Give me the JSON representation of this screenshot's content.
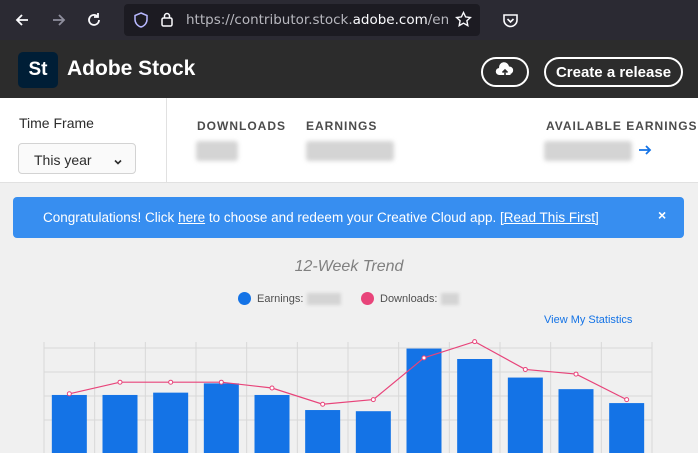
{
  "browser": {
    "url_prefix": "https://contributor.stock.",
    "url_domain": "adobe.com",
    "url_suffix": "/en/po"
  },
  "header": {
    "logo_text": "St",
    "brand": "Adobe Stock",
    "create_label": "Create a release"
  },
  "stats": {
    "time_frame_label": "Time Frame",
    "time_frame_value": "This year",
    "downloads_label": "DOWNLOADS",
    "earnings_label": "EARNINGS",
    "available_label": "AVAILABLE EARNINGS"
  },
  "banner": {
    "text_before": "Congratulations! Click ",
    "link_here": "here",
    "text_after": " to choose and redeem your Creative Cloud app. ",
    "link_read": "[Read This First]",
    "close": "×"
  },
  "chart": {
    "view_stats": "View My Statistics",
    "colors": {
      "bar": "#1473e6",
      "line": "#e8447a"
    }
  },
  "chart_data": {
    "type": "bar",
    "title": "12-Week Trend",
    "series": [
      {
        "name": "Earnings:",
        "kind": "bar",
        "color": "#1473e6",
        "values": [
          44,
          44,
          46,
          54,
          44,
          31,
          30,
          84,
          75,
          59,
          49,
          37
        ]
      },
      {
        "name": "Downloads:",
        "kind": "line",
        "color": "#e8447a",
        "values": [
          45,
          55,
          55,
          55,
          50,
          36,
          40,
          76,
          90,
          66,
          62,
          40
        ]
      }
    ],
    "ylim": [
      0,
      100
    ],
    "grid": true,
    "legend": "top-center"
  }
}
